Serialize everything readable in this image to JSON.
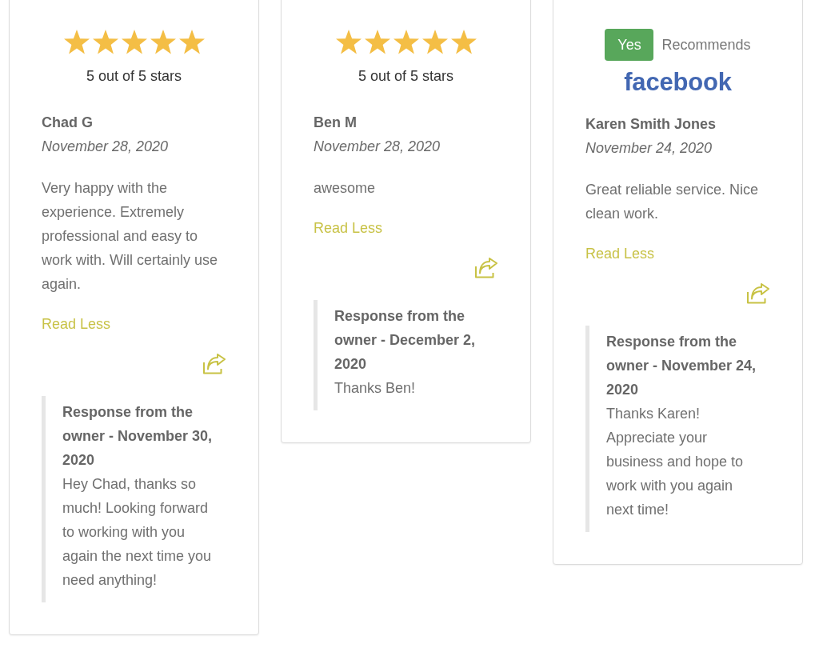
{
  "reviews": [
    {
      "kind": "stars",
      "stars": 5,
      "rating_text": "5 out of 5 stars",
      "author": "Chad G",
      "date": "November 28, 2020",
      "text": "Very happy with the experience. Extremely professional and easy to work with. Will certainly use again.",
      "toggle_link": "Read Less",
      "response": {
        "heading": "Response from the owner - November 30, 2020",
        "text": "Hey Chad, thanks so much! Looking forward to working with you again the next time you need anything!"
      }
    },
    {
      "kind": "stars",
      "stars": 5,
      "rating_text": "5 out of 5 stars",
      "author": "Ben M",
      "date": "November 28, 2020",
      "text": "awesome",
      "toggle_link": "Read Less",
      "response": {
        "heading": "Response from the owner - December 2, 2020",
        "text": "Thanks Ben!"
      }
    },
    {
      "kind": "recommendation",
      "recommendation": {
        "badge": "Yes",
        "label": "Recommends"
      },
      "source": "facebook",
      "author": "Karen Smith Jones",
      "date": "November 24, 2020",
      "text": "Great reliable service. Nice clean work.",
      "toggle_link": "Read Less",
      "response": {
        "heading": "Response from the owner - November 24, 2020",
        "text": "Thanks Karen! Appreciate your business and hope to work with you again next time!"
      }
    }
  ]
}
